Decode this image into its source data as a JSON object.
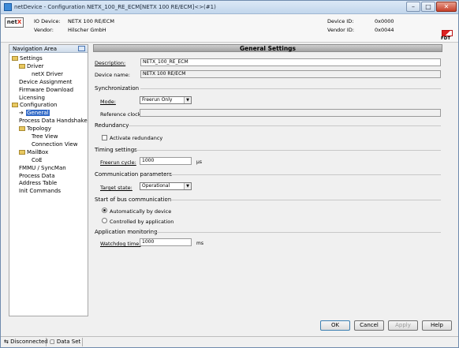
{
  "window": {
    "title": "netDevice - Configuration NETX_100_RE_ECM[NETX 100 RE/ECM]<>(#1)"
  },
  "title_buttons": {
    "minimize": "–",
    "maximize": "□",
    "close": "✕"
  },
  "logo": {
    "text_a": "net",
    "text_b": "X"
  },
  "device_info": {
    "io_device_label": "IO Device:",
    "io_device_value": "NETX 100 RE/ECM",
    "vendor_label": "Vendor:",
    "vendor_value": "Hilscher GmbH",
    "device_id_label": "Device ID:",
    "device_id_value": "0x0000",
    "vendor_id_label": "Vendor ID:",
    "vendor_id_value": "0x0044"
  },
  "fdt_logo": "FDT",
  "nav": {
    "title": "Navigation Area",
    "items": [
      {
        "label": "Settings",
        "type": "folder",
        "level": 0
      },
      {
        "label": "Driver",
        "type": "folder",
        "level": 1
      },
      {
        "label": "netX Driver",
        "type": "leaf",
        "level": 2
      },
      {
        "label": "Device Assignment",
        "type": "leaf",
        "level": 1
      },
      {
        "label": "Firmware Download",
        "type": "leaf",
        "level": 1
      },
      {
        "label": "Licensing",
        "type": "leaf",
        "level": 1
      },
      {
        "label": "Configuration",
        "type": "folder",
        "level": 0
      },
      {
        "label": "General",
        "type": "selected",
        "level": 1
      },
      {
        "label": "Process Data Handshake",
        "type": "leaf",
        "level": 1
      },
      {
        "label": "Topology",
        "type": "folder",
        "level": 1
      },
      {
        "label": "Tree View",
        "type": "leaf",
        "level": 2
      },
      {
        "label": "Connection View",
        "type": "leaf",
        "level": 2
      },
      {
        "label": "MailBox",
        "type": "folder",
        "level": 1
      },
      {
        "label": "CoE",
        "type": "leaf",
        "level": 2
      },
      {
        "label": "FMMU / SyncMan",
        "type": "leaf",
        "level": 1
      },
      {
        "label": "Process Data",
        "type": "leaf",
        "level": 1
      },
      {
        "label": "Address Table",
        "type": "leaf",
        "level": 1
      },
      {
        "label": "Init Commands",
        "type": "leaf",
        "level": 1
      }
    ]
  },
  "general": {
    "header": "General Settings",
    "description_label": "Description:",
    "description_value": "NETX_100_RE_ECM",
    "device_name_label": "Device name:",
    "device_name_value": "NETX 100 RE/ECM",
    "sync_section": "Synchronization",
    "mode_label": "Mode:",
    "mode_value": "Freerun Only",
    "reference_clock_label": "Reference clock:",
    "reference_clock_value": "",
    "redundancy_section": "Redundancy",
    "activate_redundancy_label": "Activate redundancy",
    "timing_section": "Timing settings",
    "freerun_cycle_label": "Freerun cycle:",
    "freerun_cycle_value": "1000",
    "freerun_cycle_unit": "µs",
    "comm_section": "Communication parameters",
    "target_state_label": "Target state:",
    "target_state_value": "Operational",
    "bus_section": "Start of bus communication",
    "auto_label": "Automatically by device",
    "controlled_label": "Controlled by application",
    "app_section": "Application monitoring",
    "watchdog_label": "Watchdog time:",
    "watchdog_value": "1000",
    "watchdog_unit": "ms"
  },
  "buttons": {
    "ok": "OK",
    "cancel": "Cancel",
    "apply": "Apply",
    "help": "Help"
  },
  "status": {
    "connection": "Disconnected",
    "dataset": "Data Set"
  }
}
